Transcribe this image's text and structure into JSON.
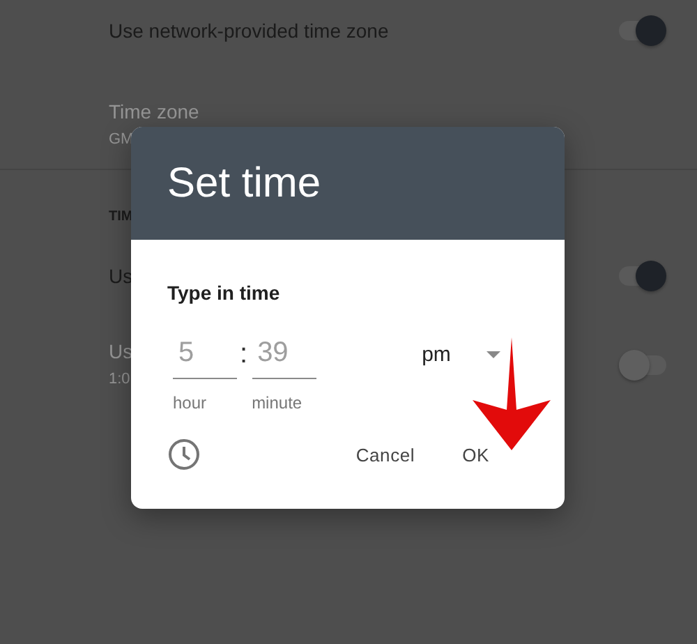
{
  "settings": [
    {
      "kind": "toggle",
      "title": "Use network-provided time zone",
      "on": true
    },
    {
      "kind": "info",
      "title": "Time zone",
      "subtitle": "GM",
      "disabled": true
    },
    {
      "kind": "divider"
    },
    {
      "kind": "header",
      "title": "TIM"
    },
    {
      "kind": "toggle",
      "title": "Us",
      "on": true
    },
    {
      "kind": "toggle",
      "title": "Us",
      "subtitle": "1:0",
      "on": false,
      "disabled": true
    }
  ],
  "dialog": {
    "title": "Set time",
    "prompt": "Type in time",
    "hour": {
      "value": "5",
      "label": "hour"
    },
    "separator": ":",
    "minute": {
      "value": "39",
      "label": "minute"
    },
    "period": "pm",
    "buttons": [
      "Cancel",
      "OK"
    ]
  }
}
